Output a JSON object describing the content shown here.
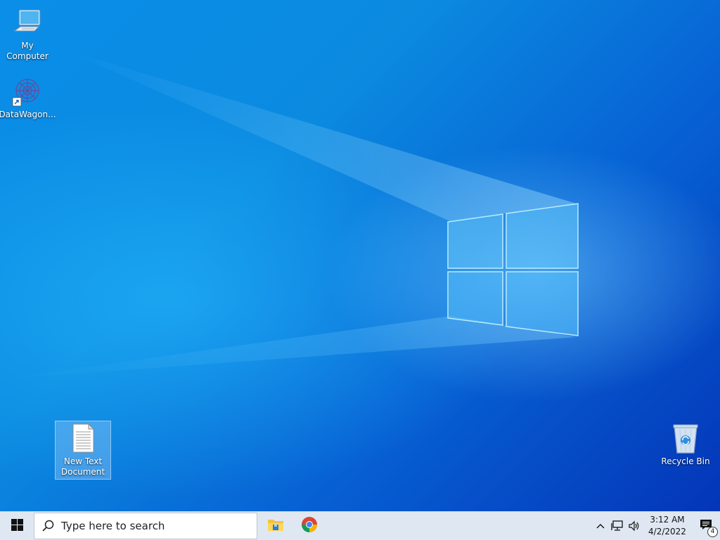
{
  "desktop": {
    "icons": [
      {
        "label": "My Computer",
        "icon": "computer-icon"
      },
      {
        "label": "DataWagon...",
        "icon": "datawagon-icon"
      },
      {
        "label": "New Text\nDocument",
        "icon": "text-document-icon"
      },
      {
        "label": "Recycle Bin",
        "icon": "recycle-bin-icon"
      }
    ]
  },
  "taskbar": {
    "start_icon": "windows-logo-icon",
    "search_placeholder": "Type here to search",
    "apps": [
      {
        "name": "File Explorer",
        "icon": "file-explorer-icon"
      },
      {
        "name": "Google Chrome",
        "icon": "chrome-icon"
      }
    ],
    "tray": {
      "time": "3:12 AM",
      "date": "4/2/2022",
      "notification_count": "4"
    }
  },
  "colors": {
    "accent": "#0a8ee8",
    "taskbar_bg": "#dfe8f2"
  }
}
